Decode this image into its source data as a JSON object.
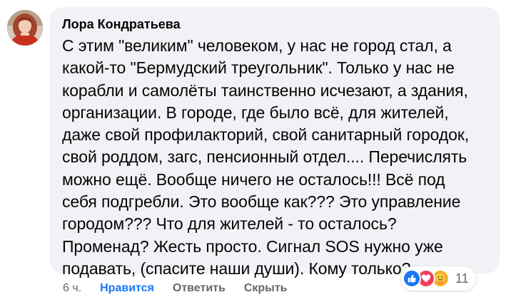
{
  "comment": {
    "author": "Лора Кондратьева",
    "lines": [
      "С этим \"великим\" человеком, у нас не город стал, а",
      "какой-то \"Бермудский треугольник\". Только у нас не",
      "корабли и самолёты таинственно исчезают, а здания,",
      "организации. В городе, где было всё, для жителей,",
      "даже свой профилакторий, свой санитарный городок,",
      "свой роддом, загс, пенсионный отдел.... Перечислять",
      "можно ещё. Вообще ничего не осталось!!! Всё под",
      "себя подгребли. Это вообще как??? Это управление",
      "городом??? Что для жителей - то осталось?",
      "Променад? Жесть просто. Сигнал SOS нужно уже",
      "подавать, (спасите наши души). Кому только?"
    ]
  },
  "reactions": {
    "icons": [
      "like-icon",
      "love-icon",
      "care-icon"
    ],
    "count": "11"
  },
  "actions": {
    "time": "6 ч.",
    "like_label": "Нравится",
    "reply_label": "Ответить",
    "hide_label": "Скрыть"
  },
  "colors": {
    "bubble": "#f0f2f5",
    "text": "#050505",
    "secondary": "#65676b",
    "like_active": "#1877f2"
  }
}
